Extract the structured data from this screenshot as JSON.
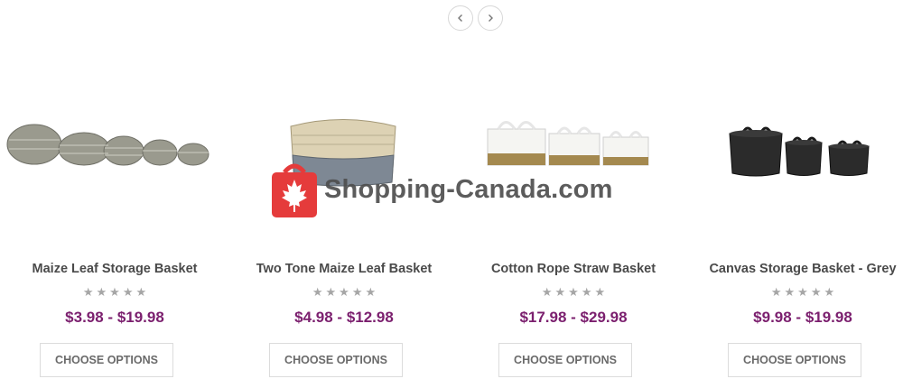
{
  "carousel": {
    "prev_icon": "chevron-left-icon",
    "next_icon": "chevron-right-icon"
  },
  "products": [
    {
      "name": "Maize Leaf Storage Basket",
      "price": "$3.98 - $19.98",
      "rating": 0,
      "button_label": "CHOOSE OPTIONS"
    },
    {
      "name": "Two Tone Maize Leaf Basket",
      "price": "$4.98 - $12.98",
      "rating": 0,
      "button_label": "CHOOSE OPTIONS"
    },
    {
      "name": "Cotton Rope Straw Basket",
      "price": "$17.98 - $29.98",
      "rating": 0,
      "button_label": "CHOOSE OPTIONS"
    },
    {
      "name": "Canvas Storage Basket - Grey",
      "price": "$9.98 - $19.98",
      "rating": 0,
      "button_label": "CHOOSE OPTIONS"
    }
  ],
  "colors": {
    "price": "#7b1f6e",
    "star": "#a6a6a6",
    "watermark_red": "#e53b3b"
  },
  "watermark": {
    "text": "Shopping-Canada.com"
  }
}
